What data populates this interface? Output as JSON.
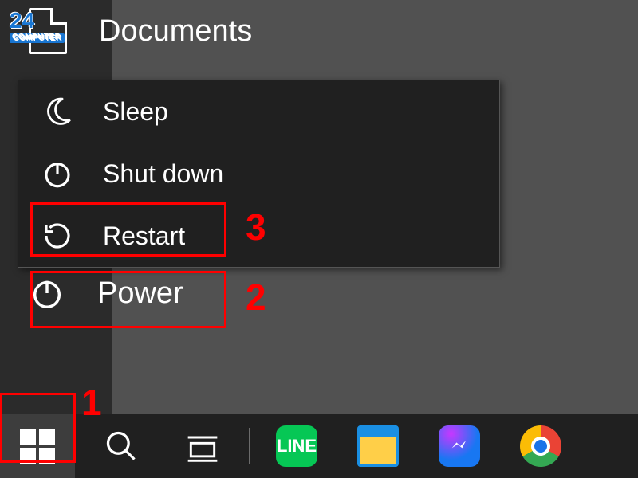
{
  "watermark": {
    "brand_number": "24",
    "brand_word": "COMPUTER"
  },
  "start_menu": {
    "documents_label": "Documents",
    "power_flyout": {
      "sleep": "Sleep",
      "shutdown": "Shut down",
      "restart": "Restart"
    },
    "power_button_label": "Power"
  },
  "annotations": {
    "step1": "1",
    "step2": "2",
    "step3": "3",
    "color": "#ff0000"
  },
  "taskbar": {
    "apps": [
      "LINE",
      "File Explorer",
      "Messenger",
      "Chrome"
    ]
  }
}
